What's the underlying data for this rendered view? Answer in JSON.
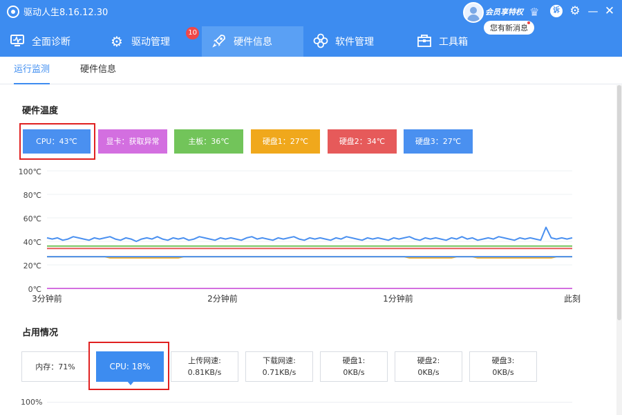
{
  "app": {
    "title": "驱动人生8.16.12.30"
  },
  "vip": {
    "label": "会员享特权",
    "notice": "您有新消息"
  },
  "window": {
    "complain_label": "诉",
    "settings_icon": "gear-icon",
    "minimize_glyph": "—",
    "close_glyph": "✕"
  },
  "nav": {
    "items": [
      {
        "label": "全面诊断",
        "icon": "monitor-icon"
      },
      {
        "label": "驱动管理",
        "icon": "gear-icon",
        "badge": "10"
      },
      {
        "label": "硬件信息",
        "icon": "rocket-icon"
      },
      {
        "label": "软件管理",
        "icon": "flower-icon"
      },
      {
        "label": "工具箱",
        "icon": "toolbox-icon"
      }
    ],
    "active": "硬件信息"
  },
  "subtabs": {
    "items": [
      "运行监测",
      "硬件信息"
    ],
    "active": "运行监测"
  },
  "temperature": {
    "title": "硬件温度",
    "chips": [
      {
        "label": "CPU：43℃",
        "color": "#4a90f0"
      },
      {
        "label": "显卡：获取异常",
        "color": "#d36fe0"
      },
      {
        "label": "主板：36℃",
        "color": "#72c45a"
      },
      {
        "label": "硬盘1：27℃",
        "color": "#f0a81c"
      },
      {
        "label": "硬盘2：34℃",
        "color": "#e65a5a"
      },
      {
        "label": "硬盘3：27℃",
        "color": "#4a90f0"
      }
    ]
  },
  "usage": {
    "title": "占用情况",
    "boxes": [
      {
        "line1": "内存：71%",
        "line2": ""
      },
      {
        "line1": "CPU: 18%",
        "line2": ""
      },
      {
        "line1": "上传网速:",
        "line2": "0.81KB/s"
      },
      {
        "line1": "下载网速:",
        "line2": "0.71KB/s"
      },
      {
        "line1": "硬盘1:",
        "line2": "0KB/s"
      },
      {
        "line1": "硬盘2:",
        "line2": "0KB/s"
      },
      {
        "line1": "硬盘3:",
        "line2": "0KB/s"
      }
    ],
    "chart_top_label": "100%"
  },
  "chart_data": {
    "type": "line",
    "y_tick_labels": [
      "100℃",
      "80℃",
      "60℃",
      "40℃",
      "20℃",
      "0℃"
    ],
    "x_tick_labels": [
      "3分钟前",
      "2分钟前",
      "1分钟前",
      "此刻"
    ],
    "ylim": [
      0,
      100
    ],
    "grid": true,
    "series": [
      {
        "color": "#4a90f0",
        "values": [
          43,
          42,
          43,
          41,
          42,
          44,
          43,
          42,
          41,
          43,
          42,
          43,
          44,
          42,
          41,
          43,
          42,
          40,
          42,
          43,
          42,
          44,
          42,
          41,
          43,
          42,
          43,
          41,
          42,
          44,
          43,
          42,
          41,
          43,
          42,
          43,
          42,
          41,
          43,
          44,
          42,
          43,
          42,
          41,
          43,
          42,
          43,
          44,
          42,
          41,
          43,
          42,
          43,
          42,
          41,
          43,
          42,
          44,
          43,
          42,
          41,
          43,
          42,
          43,
          42,
          41,
          43,
          42,
          43,
          44,
          42,
          41,
          43,
          42,
          43,
          42,
          41,
          43,
          42,
          44,
          42,
          43,
          41,
          42,
          43,
          42,
          44,
          43,
          42,
          41,
          43,
          42,
          43,
          42,
          41,
          52,
          43,
          42,
          43,
          42,
          43
        ]
      },
      {
        "color": "#72c45a",
        "values": [
          36,
          36,
          36,
          36,
          36,
          36,
          36,
          36,
          36,
          36,
          36,
          36,
          36,
          36,
          36,
          36,
          36,
          36,
          36,
          36,
          36,
          36,
          36,
          36,
          36,
          36,
          36,
          36,
          36,
          36,
          36,
          36,
          36,
          36,
          36,
          36,
          36,
          36,
          36,
          36,
          36,
          36,
          36,
          36,
          36,
          36,
          36,
          36,
          36,
          36,
          36,
          36,
          36,
          36,
          36,
          36,
          36,
          36,
          36,
          36,
          36,
          36,
          36,
          36,
          36,
          36,
          36,
          36,
          36,
          36,
          36,
          36,
          36,
          36,
          36,
          36,
          36,
          36,
          36,
          36,
          36,
          36,
          36,
          36,
          36,
          36,
          36,
          36,
          36,
          36,
          36,
          36,
          36,
          36,
          36,
          36,
          36,
          36,
          36,
          36,
          36
        ]
      },
      {
        "color": "#e65a5a",
        "values": [
          34,
          34,
          34,
          34,
          34,
          34,
          34,
          34,
          34,
          34,
          34,
          34,
          34,
          34,
          34,
          34,
          34,
          34,
          34,
          34,
          34,
          34,
          34,
          34,
          34,
          34,
          34,
          34,
          34,
          34,
          34,
          34,
          34,
          34,
          34,
          34,
          34,
          34,
          34,
          34,
          34,
          34,
          34,
          34,
          34,
          34,
          34,
          34,
          34,
          34,
          34,
          34,
          34,
          34,
          34,
          34,
          34,
          34,
          34,
          34,
          34,
          34,
          34,
          34,
          34,
          34,
          34,
          34,
          34,
          34,
          34,
          34,
          34,
          34,
          34,
          34,
          34,
          34,
          34,
          34,
          34,
          34,
          34,
          34,
          34,
          34,
          34,
          34,
          34,
          34,
          34,
          34,
          34,
          34,
          34,
          34,
          34,
          34,
          34,
          34,
          34
        ]
      },
      {
        "color": "#f0a81c",
        "values": [
          27,
          27,
          27,
          27,
          27,
          27,
          27,
          27,
          27,
          27,
          27,
          27,
          26,
          26,
          26,
          26,
          26,
          26,
          26,
          26,
          26,
          26,
          26,
          26,
          26,
          26,
          27,
          27,
          27,
          27,
          27,
          27,
          27,
          27,
          27,
          27,
          27,
          27,
          27,
          27,
          27,
          27,
          27,
          27,
          27,
          27,
          27,
          27,
          27,
          27,
          27,
          27,
          27,
          27,
          27,
          27,
          27,
          27,
          27,
          27,
          27,
          27,
          27,
          27,
          27,
          27,
          27,
          27,
          27,
          26,
          26,
          26,
          26,
          26,
          26,
          26,
          26,
          26,
          27,
          27,
          27,
          27,
          26,
          26,
          26,
          26,
          26,
          26,
          26,
          26,
          26,
          26,
          26,
          26,
          26,
          26,
          26,
          27,
          27,
          27,
          27
        ]
      },
      {
        "color": "#4a90f0",
        "values": [
          27,
          27,
          27,
          27,
          27,
          27,
          27,
          27,
          27,
          27,
          27,
          27,
          27,
          27,
          27,
          27,
          27,
          27,
          27,
          27,
          27,
          27,
          27,
          27,
          27,
          27,
          27,
          27,
          27,
          27,
          27,
          27,
          27,
          27,
          27,
          27,
          27,
          27,
          27,
          27,
          27,
          27,
          27,
          27,
          27,
          27,
          27,
          27,
          27,
          27,
          27,
          27,
          27,
          27,
          27,
          27,
          27,
          27,
          27,
          27,
          27,
          27,
          27,
          27,
          27,
          27,
          27,
          27,
          27,
          27,
          27,
          27,
          27,
          27,
          27,
          27,
          27,
          27,
          27,
          27,
          27,
          27,
          27,
          27,
          27,
          27,
          27,
          27,
          27,
          27,
          27,
          27,
          27,
          27,
          27,
          27,
          27,
          27,
          27,
          27,
          27
        ]
      },
      {
        "color": "#d36fe0",
        "values": [
          0,
          0,
          0,
          0,
          0,
          0,
          0,
          0,
          0,
          0,
          0,
          0,
          0,
          0,
          0,
          0,
          0,
          0,
          0,
          0,
          0,
          0,
          0,
          0,
          0,
          0,
          0,
          0,
          0,
          0,
          0,
          0,
          0,
          0,
          0,
          0,
          0,
          0,
          0,
          0,
          0,
          0,
          0,
          0,
          0,
          0,
          0,
          0,
          0,
          0,
          0,
          0,
          0,
          0,
          0,
          0,
          0,
          0,
          0,
          0,
          0,
          0,
          0,
          0,
          0,
          0,
          0,
          0,
          0,
          0,
          0,
          0,
          0,
          0,
          0,
          0,
          0,
          0,
          0,
          0,
          0,
          0,
          0,
          0,
          0,
          0,
          0,
          0,
          0,
          0,
          0,
          0,
          0,
          0,
          0,
          0,
          0,
          0,
          0,
          0,
          0
        ]
      }
    ]
  }
}
